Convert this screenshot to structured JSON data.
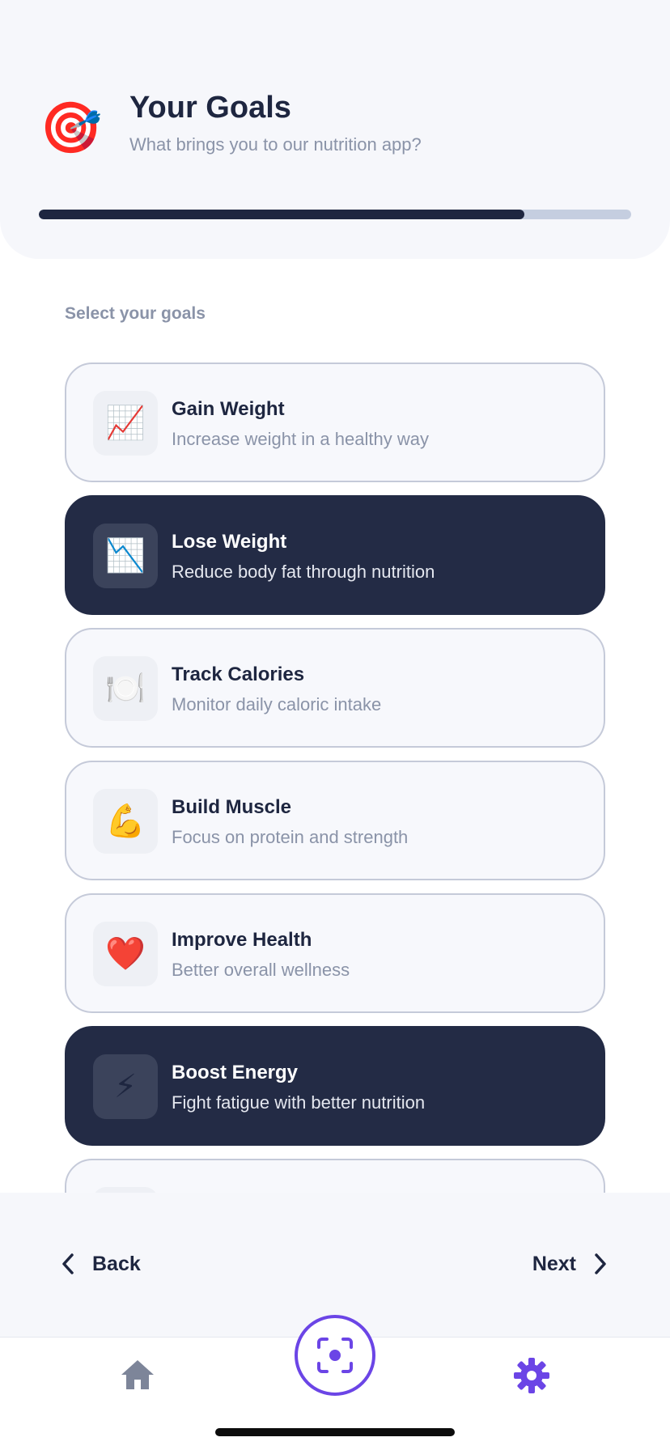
{
  "header": {
    "icon": "🎯",
    "icon_name": "target-icon",
    "title": "Your Goals",
    "subtitle": "What brings you to our nutrition app?",
    "progress": 0.82
  },
  "section_label": "Select your goals",
  "goals": [
    {
      "icon": "📈",
      "icon_name": "chart-increasing-icon",
      "title": "Gain Weight",
      "description": "Increase weight in a healthy way",
      "selected": false
    },
    {
      "icon": "📉",
      "icon_name": "chart-decreasing-icon",
      "title": "Lose Weight",
      "description": "Reduce body fat through nutrition",
      "selected": true
    },
    {
      "icon": "🍽️",
      "icon_name": "plate-icon",
      "title": "Track Calories",
      "description": "Monitor daily caloric intake",
      "selected": false
    },
    {
      "icon": "💪",
      "icon_name": "flexed-biceps-icon",
      "title": "Build Muscle",
      "description": "Focus on protein and strength",
      "selected": false
    },
    {
      "icon": "❤️",
      "icon_name": "heart-icon",
      "title": "Improve Health",
      "description": "Better overall wellness",
      "selected": false
    },
    {
      "icon": "⚡",
      "icon_name": "lightning-icon",
      "title": "Boost Energy",
      "description": "Fight fatigue with better nutrition",
      "selected": true
    },
    {
      "icon": "",
      "icon_name": "",
      "title": "",
      "description": "",
      "selected": false
    }
  ],
  "nav": {
    "back_label": "Back",
    "next_label": "Next"
  },
  "tabs": {
    "home_icon": "home-icon",
    "scan_icon": "scan-icon",
    "settings_icon": "gear-icon",
    "active_color": "#6b45e6",
    "inactive_color": "#7d8599"
  },
  "colors": {
    "primary_dark": "#1e2640",
    "selected_card": "#232b45",
    "accent": "#6b45e6",
    "progress_track": "#c5cee0"
  }
}
